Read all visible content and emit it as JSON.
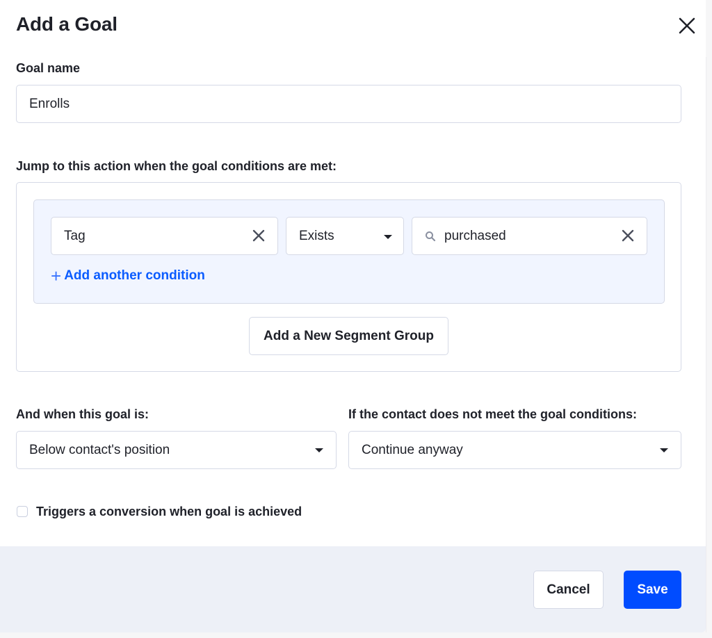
{
  "modal": {
    "title": "Add a Goal",
    "close_icon": "close-icon"
  },
  "goal_name": {
    "label": "Goal name",
    "value": "Enrolls"
  },
  "conditions": {
    "label": "Jump to this action when the goal conditions are met:",
    "rows": [
      {
        "field": "Tag",
        "operator": "Exists",
        "value": "purchased"
      }
    ],
    "add_condition_label": "Add another condition",
    "add_segment_group_label": "Add a New Segment Group"
  },
  "position": {
    "label": "And when this goal is:",
    "selected": "Below contact's position"
  },
  "fallback": {
    "label": "If the contact does not meet the goal conditions:",
    "selected": "Continue anyway"
  },
  "conversion": {
    "label": "Triggers a conversion when goal is achieved",
    "checked": false
  },
  "footer": {
    "cancel_label": "Cancel",
    "save_label": "Save"
  },
  "colors": {
    "primary": "#004cff",
    "link": "#0b5cff",
    "group_bg": "#f1f5ff",
    "footer_bg": "#edf0f7",
    "border": "#d5d9e6"
  }
}
